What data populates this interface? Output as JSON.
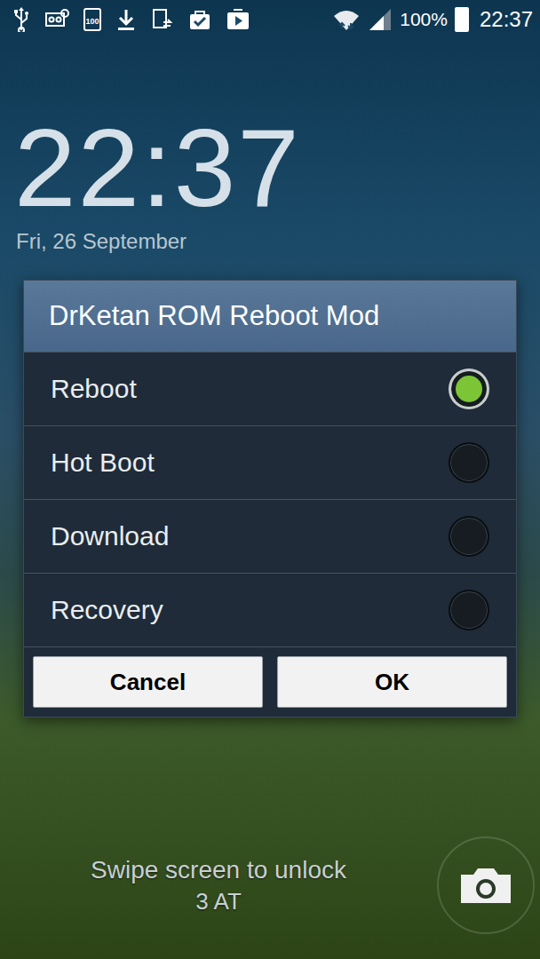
{
  "status_bar": {
    "icon_label": "100",
    "battery_percent": "100%",
    "battery_level": 1.0,
    "time": "22:37"
  },
  "lockscreen": {
    "clock": "22:37",
    "date": "Fri, 26 September",
    "hint": "Swipe screen to unlock",
    "carrier": "3 AT"
  },
  "dialog": {
    "title": "DrKetan ROM Reboot Mod",
    "options": [
      {
        "label": "Reboot",
        "selected": true
      },
      {
        "label": "Hot Boot",
        "selected": false
      },
      {
        "label": "Download",
        "selected": false
      },
      {
        "label": "Recovery",
        "selected": false
      }
    ],
    "buttons": [
      "Cancel",
      "OK"
    ]
  }
}
